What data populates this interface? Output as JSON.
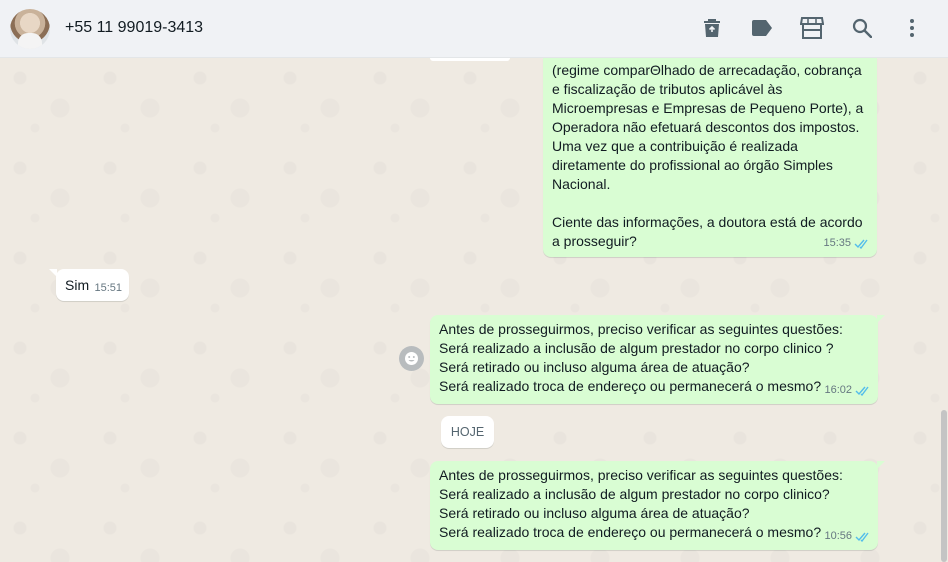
{
  "header": {
    "contact_name": "+55 11 99019-3413",
    "icons": [
      "trash-icon",
      "label-icon",
      "store-icon",
      "search-icon",
      "menu-icon"
    ]
  },
  "messages": [
    {
      "direction": "outgoing",
      "text": "(regime comparΘlhado de arrecadação, cobrança\ne fiscalização de tributos aplicável às\nMicroempresas e Empresas de Pequeno Porte), a\nOperadora não efetuará descontos dos impostos.\nUma vez que a contribuição é realizada\ndiretamente do profissional ao órgão Simples\nNacional.\n\nCiente das informações, a doutora está de acordo\na prosseguir?",
      "time": "15:35",
      "status": "read"
    },
    {
      "direction": "incoming",
      "text": "Sim",
      "time": "15:51"
    },
    {
      "direction": "outgoing",
      "text": "Antes de prosseguirmos, preciso verificar as seguintes questões:\nSerá realizado a inclusão de algum prestador no corpo clinico ?\nSerá retirado ou incluso alguma área de atuação?\nSerá realizado troca de endereço ou permanecerá o mesmo?",
      "time": "16:02",
      "status": "read"
    },
    {
      "direction": "outgoing",
      "text": "Antes de prosseguirmos, preciso verificar as seguintes questões:\nSerá realizado a inclusão de algum prestador no corpo clinico?\nSerá retirado ou incluso alguma área de atuação?\nSerá realizado troca de endereço ou permanecerá o mesmo?",
      "time": "10:56",
      "status": "read"
    }
  ],
  "date_divider": "HOJE",
  "colors": {
    "outgoing_bubble": "#d9fdd3",
    "incoming_bubble": "#ffffff",
    "read_tick": "#53bdeb",
    "header_bg": "#f0f2f5",
    "chat_bg": "#efeae2"
  }
}
